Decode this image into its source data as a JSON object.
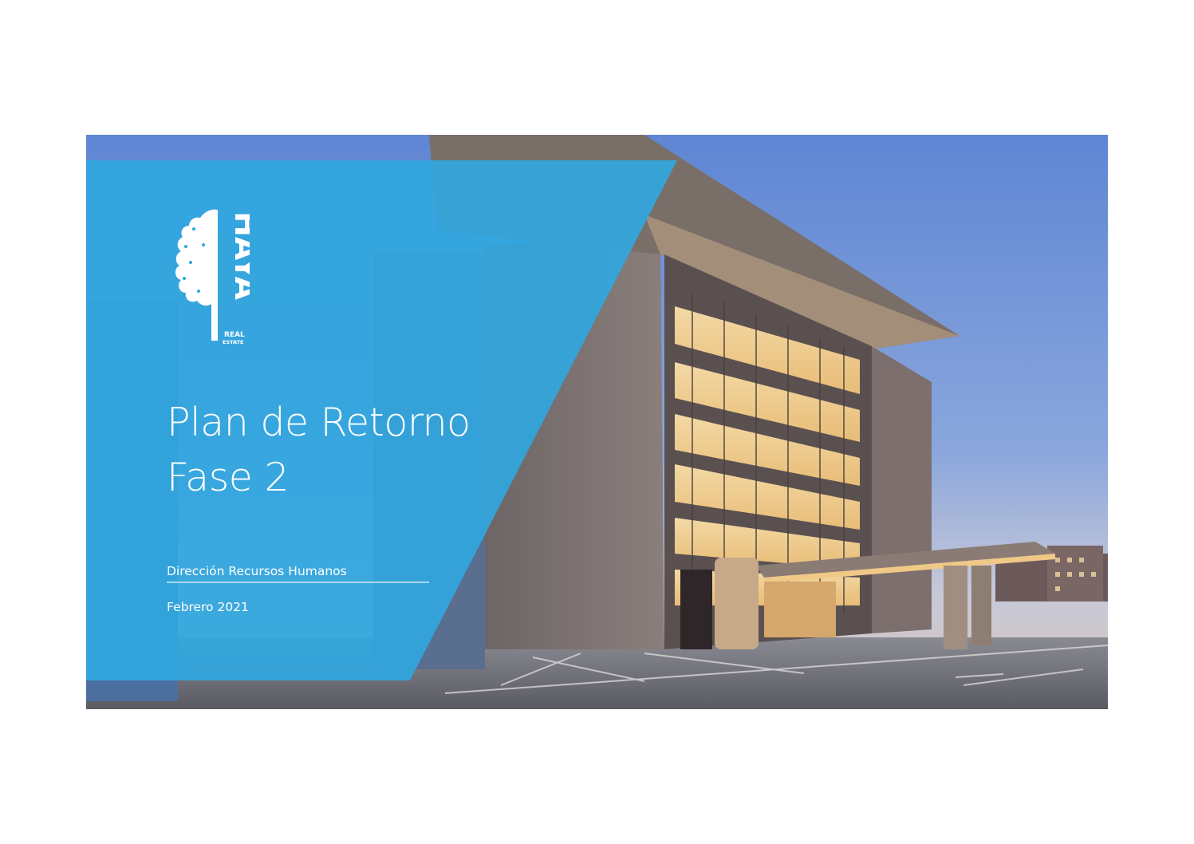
{
  "brand": {
    "logo_word": "HAYA",
    "logo_tagline_line1": "REAL",
    "logo_tagline_line2": "ESTATE",
    "accent_color": "#2ea7e0"
  },
  "slide": {
    "title_line1": "Plan de Retorno",
    "title_line2": "Fase 2",
    "subtitle": "Dirección Recursos Humanos",
    "date": "Febrero 2021"
  }
}
